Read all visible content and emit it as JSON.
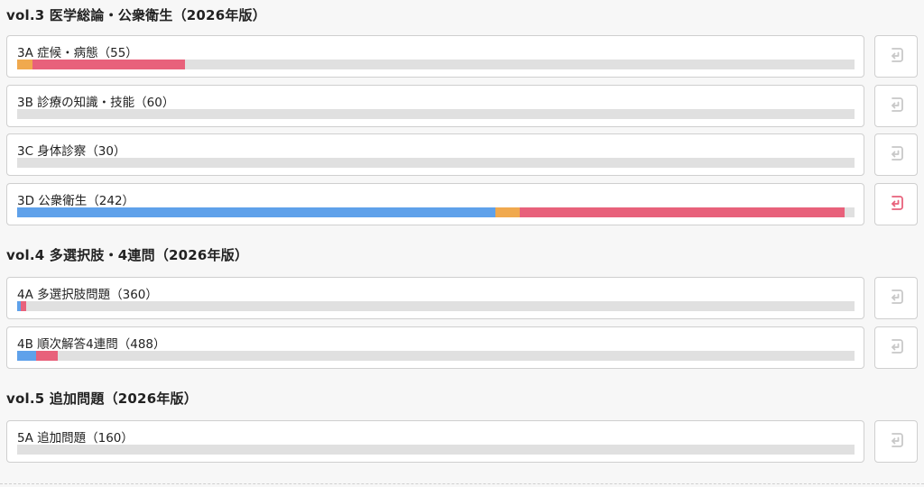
{
  "sections": [
    {
      "title": "vol.3 医学総論・公衆衛生（2026年版）",
      "items": [
        {
          "label": "3A 症候・病態（55）",
          "progress": {
            "blue": 0.0,
            "orange": 0.018,
            "red": 0.182
          },
          "active": false
        },
        {
          "label": "3B 診療の知識・技能（60）",
          "progress": {
            "blue": 0.0,
            "orange": 0.0,
            "red": 0.0
          },
          "active": false
        },
        {
          "label": "3C 身体診察（30）",
          "progress": {
            "blue": 0.0,
            "orange": 0.0,
            "red": 0.0
          },
          "active": false
        },
        {
          "label": "3D 公衆衛生（242）",
          "progress": {
            "blue": 0.571,
            "orange": 0.029,
            "red": 0.388
          },
          "active": true
        }
      ]
    },
    {
      "title": "vol.4 多選択肢・4連問（2026年版）",
      "items": [
        {
          "label": "4A 多選択肢問題（360）",
          "progress": {
            "blue": 0.004,
            "orange": 0.0,
            "red": 0.007
          },
          "active": false
        },
        {
          "label": "4B 順次解答4連問（488）",
          "progress": {
            "blue": 0.023,
            "orange": 0.0,
            "red": 0.026
          },
          "active": false
        }
      ]
    },
    {
      "title": "vol.5 追加問題（2026年版）",
      "items": [
        {
          "label": "5A 追加問題（160）",
          "progress": {
            "blue": 0.0,
            "orange": 0.0,
            "red": 0.0
          },
          "active": false
        }
      ]
    }
  ],
  "colors": {
    "blue": "#5fa1ea",
    "orange": "#f0a94e",
    "red": "#e8617b",
    "icon_inactive": "#c8c8c8",
    "icon_active": "#e8617b"
  },
  "icons": {
    "action": "enter-return-icon"
  }
}
